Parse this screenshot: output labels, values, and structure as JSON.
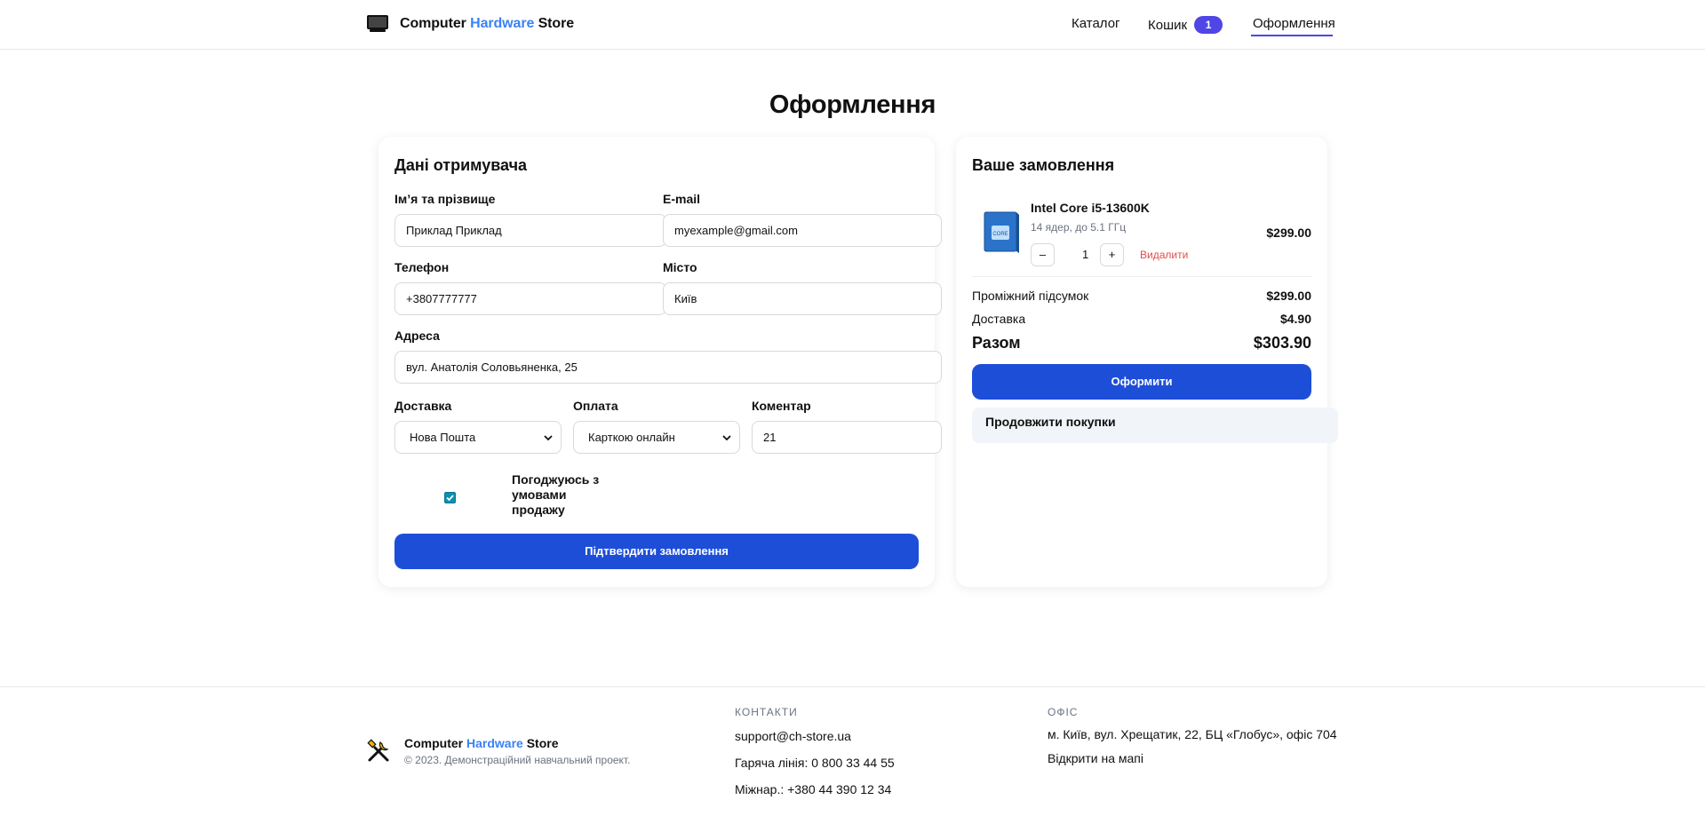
{
  "header": {
    "brand": {
      "part1": "Computer",
      "part2": "Hardware",
      "part3": "Store"
    },
    "nav": {
      "catalog": "Каталог",
      "cart": "Кошик",
      "cart_count": "1",
      "checkout": "Оформлення"
    }
  },
  "page": {
    "title": "Оформлення"
  },
  "form": {
    "section_title": "Дані отримувача",
    "name": {
      "label": "Ім’я та прізвище",
      "value": "Приклад Приклад"
    },
    "email": {
      "label": "E-mail",
      "value": "myexample@gmail.com"
    },
    "phone": {
      "label": "Телефон",
      "value": "+3807777777"
    },
    "city": {
      "label": "Місто",
      "value": "Київ"
    },
    "address": {
      "label": "Адреса",
      "value": "вул. Анатолія Соловьяненка, 25"
    },
    "delivery": {
      "label": "Доставка",
      "value": "Нова Пошта"
    },
    "payment": {
      "label": "Оплата",
      "value": "Карткою онлайн"
    },
    "comment": {
      "label": "Коментар",
      "value": "21"
    },
    "agree": {
      "label": "Погоджуюсь з умовами продажу",
      "checked": true
    },
    "submit_label": "Підтвердити замовлення"
  },
  "order": {
    "section_title": "Ваше замовлення",
    "item": {
      "name": "Intel Core i5-13600K",
      "desc": "14 ядер, до 5.1 ГГц",
      "qty": "1",
      "minus": "–",
      "plus": "+",
      "remove": "Видалити",
      "price": "$299.00"
    },
    "subtotal": {
      "label": "Проміжний підсумок",
      "value": "$299.00"
    },
    "shipping": {
      "label": "Доставка",
      "value": "$4.90"
    },
    "total": {
      "label": "Разом",
      "value": "$303.90"
    },
    "checkout_label": "Оформити",
    "continue_label": "Продовжити покупки"
  },
  "footer": {
    "brand": {
      "part1": "Computer",
      "part2": "Hardware",
      "part3": "Store"
    },
    "copyright": "© 2023. Демонстраційний навчальний проект.",
    "contacts": {
      "heading": "КОНТАКТИ",
      "email": "support@ch-store.ua",
      "hotline": "Гаряча лінія: 0 800 33 44 55",
      "intl": "Міжнар.: +380 44 390 12 34"
    },
    "office": {
      "heading": "ОФІС",
      "address": "м. Київ, вул. Хрещатик, 22, БЦ «Глобус», офіс 704",
      "map_link": "Відкрити на мапі"
    }
  },
  "colors": {
    "primary": "#1d4ed8",
    "accent": "#4f46e5",
    "brand_blue": "#3b82f6",
    "danger": "#e24b4b"
  },
  "icons": {
    "logo": "monitor-icon",
    "footer_logo": "tools-icon",
    "select": "chevron-down-icon"
  }
}
